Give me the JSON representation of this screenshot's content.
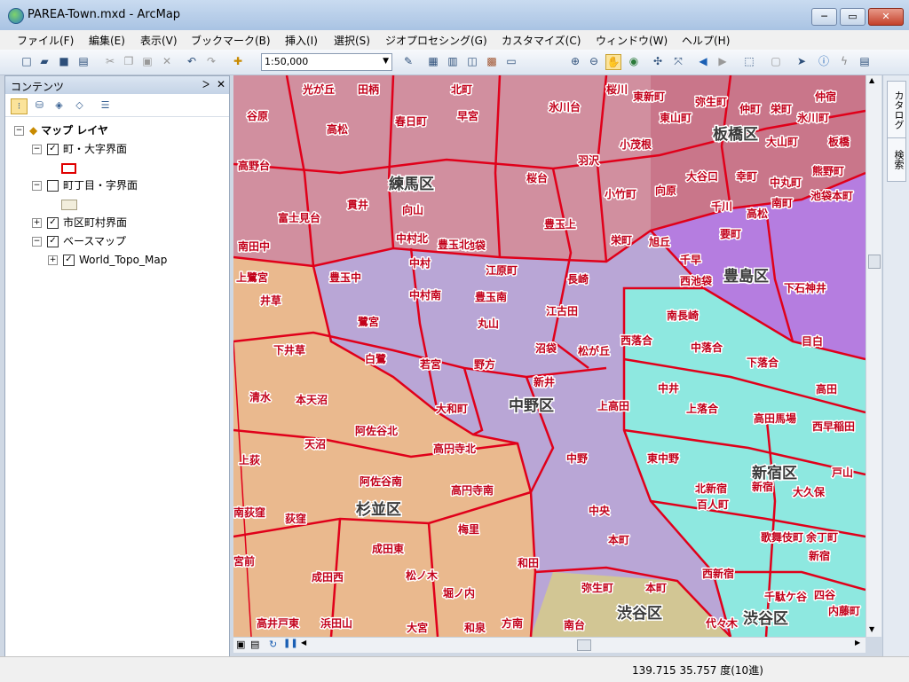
{
  "window": {
    "title": "PAREA-Town.mxd - ArcMap",
    "min": "─",
    "max": "▭",
    "close": "✕"
  },
  "menu": [
    "ファイル(F)",
    "編集(E)",
    "表示(V)",
    "ブックマーク(B)",
    "挿入(I)",
    "選択(S)",
    "ジオプロセシング(G)",
    "カスタマイズ(C)",
    "ウィンドウ(W)",
    "ヘルプ(H)"
  ],
  "toolbar": {
    "scale": "1:50,000"
  },
  "toc": {
    "title": "コンテンツ",
    "root": "マップ レイヤ",
    "layers": [
      {
        "name": "町・大字界面",
        "checked": true,
        "symbol_color": "#e00000"
      },
      {
        "name": "町丁目・字界面",
        "checked": false,
        "symbol_color": "#d9d2b8"
      },
      {
        "name": "市区町村界面",
        "checked": true
      },
      {
        "name": "ベースマップ",
        "checked": true
      },
      {
        "name": "World_Topo_Map",
        "checked": true
      }
    ]
  },
  "dock": {
    "catalog": "カタログ",
    "search": "検索"
  },
  "status": {
    "coordinates": "139.715  35.757 度(10進)"
  },
  "map": {
    "ward_labels": [
      "練馬区",
      "板橋区",
      "豊島区",
      "中野区",
      "新宿区",
      "杉並区",
      "渋谷区",
      "渋谷区"
    ],
    "town_labels": [
      "光が丘",
      "田柄",
      "北町",
      "桜川",
      "東新町",
      "弥生町",
      "仲宿",
      "谷原",
      "春日町",
      "早宮",
      "氷川台",
      "東山町",
      "仲町",
      "栄町",
      "氷川町",
      "高松",
      "小茂根",
      "大山町",
      "板橋",
      "高野台",
      "羽沢",
      "大谷口",
      "幸町",
      "熊野町",
      "桜台",
      "向原",
      "中丸町",
      "貫井",
      "向山",
      "小竹町",
      "千川",
      "高松",
      "南町",
      "池袋本町",
      "南田中",
      "富士見台",
      "中村北",
      "豊玉上",
      "栄町",
      "要町",
      "池袋",
      "中村",
      "豊玉北",
      "旭丘",
      "千早",
      "下石神井",
      "上鷺宮",
      "豊玉中",
      "江原町",
      "長崎",
      "西池袋",
      "井草",
      "中村南",
      "豊玉南",
      "江古田",
      "南長崎",
      "鷺宮",
      "丸山",
      "西落合",
      "中落合",
      "目白",
      "下井草",
      "白鷺",
      "沼袋",
      "松が丘",
      "下落合",
      "若宮",
      "野方",
      "清水",
      "新井",
      "中井",
      "高田",
      "本天沼",
      "大和町",
      "上高田",
      "上落合",
      "高田馬場",
      "阿佐谷北",
      "西早稲田",
      "天沼",
      "高円寺北",
      "上荻",
      "中野",
      "東中野",
      "戸山",
      "阿佐谷南",
      "新宿",
      "高円寺南",
      "北新宿",
      "百人町",
      "大久保",
      "南荻窪",
      "荻窪",
      "中央",
      "梅里",
      "歌舞伎町",
      "余丁町",
      "成田東",
      "本町",
      "新宿",
      "宮前",
      "和田",
      "成田西",
      "松ノ木",
      "西新宿",
      "四谷",
      "堀ノ内",
      "弥生町",
      "本町",
      "千駄ケ谷",
      "内藤町",
      "高井戸東",
      "浜田山",
      "方南",
      "大宮",
      "和泉",
      "南台",
      "代々木"
    ]
  }
}
